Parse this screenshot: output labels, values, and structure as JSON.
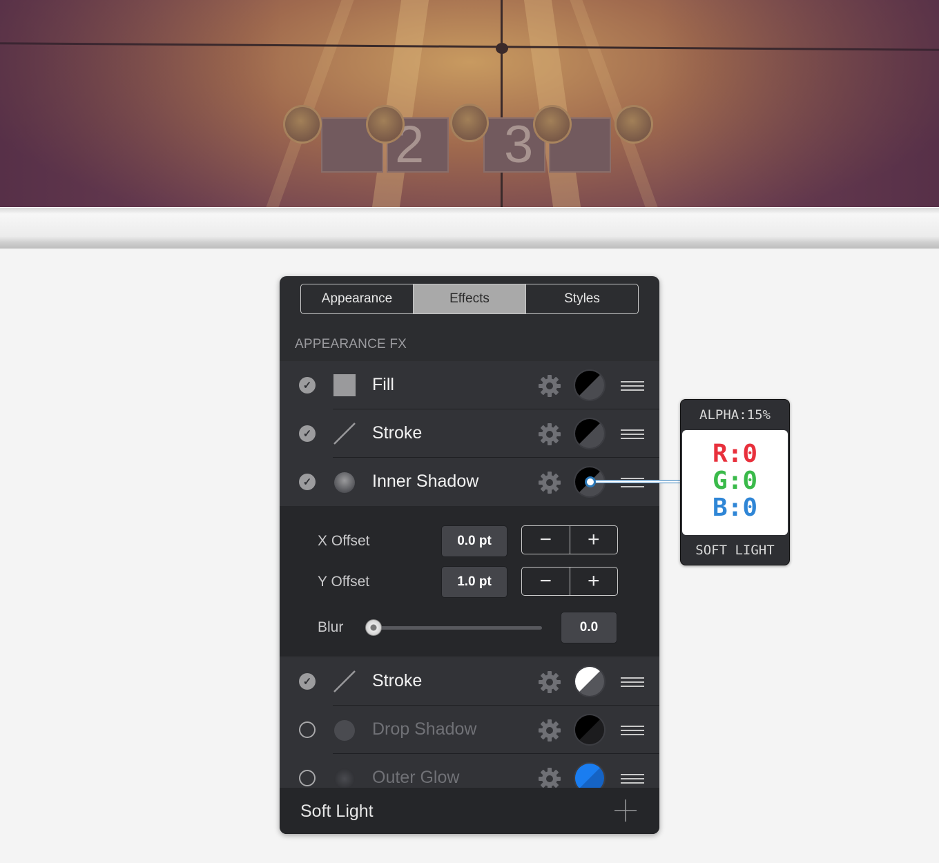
{
  "photo": {
    "sign_numbers": [
      "2",
      "3"
    ]
  },
  "panel": {
    "tabs": [
      {
        "label": "Appearance",
        "active": false
      },
      {
        "label": "Effects",
        "active": true
      },
      {
        "label": "Styles",
        "active": false
      }
    ],
    "section_title": "APPEARANCE FX",
    "effects": [
      {
        "label": "Fill",
        "checked": true,
        "icon": "square-fill-icon",
        "swatch": "black-gray-swatch"
      },
      {
        "label": "Stroke",
        "checked": true,
        "icon": "line-stroke-icon",
        "swatch": "black-gray-swatch"
      },
      {
        "label": "Inner Shadow",
        "checked": true,
        "icon": "shadow-circle-icon",
        "swatch": "black-gray-swatch"
      },
      {
        "label": "Stroke",
        "checked": true,
        "icon": "line-stroke-icon",
        "swatch": "white-gray-swatch"
      },
      {
        "label": "Drop Shadow",
        "checked": false,
        "icon": "shadow-circle-icon",
        "swatch": "black-swatch"
      },
      {
        "label": "Outer Glow",
        "checked": false,
        "icon": "glow-circle-icon",
        "swatch": "blue-swatch"
      }
    ],
    "inner_shadow_settings": {
      "x_offset_label": "X Offset",
      "x_offset_value": "0.0 pt",
      "y_offset_label": "Y Offset",
      "y_offset_value": "1.0 pt",
      "blur_label": "Blur",
      "blur_value": "0.0",
      "stepper_minus": "−",
      "stepper_plus": "+"
    },
    "footer_label": "Soft Light"
  },
  "callout": {
    "alpha": "ALPHA:15%",
    "r": "R:0",
    "g": "G:0",
    "b": "B:0",
    "blend_mode": "SOFT LIGHT"
  },
  "colors": {
    "panel_bg": "#2c2d30",
    "accent_blue": "#1a7df0",
    "callout_red": "#e8303c",
    "callout_green": "#3aba4a",
    "callout_blue": "#2f86d6"
  }
}
